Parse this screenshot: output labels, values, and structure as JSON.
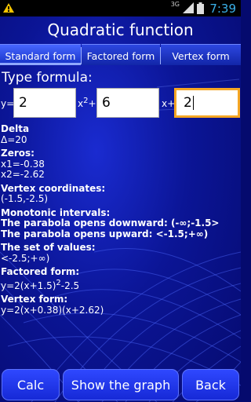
{
  "status": {
    "network": "3G",
    "time": "7:39"
  },
  "title": "Quadratic function",
  "tabs": [
    "Standard form",
    "Factored form",
    "Vertex form"
  ],
  "type_formula_label": "Type formula:",
  "inputs": {
    "y_label": "y=",
    "a": "2",
    "x2_label": "x",
    "x2_exp": "2",
    "x2_plus": "+",
    "b": "6",
    "x_label": "x+",
    "c": "2"
  },
  "results": {
    "delta_title": "Delta",
    "delta_value": "Δ=20",
    "zeros_title": "Zeros:",
    "x1": "x1=-0.38",
    "x2": "x2=-2.62",
    "vertex_title": "Vertex coordinates:",
    "vertex_value": "(-1.5,-2.5)",
    "monotonic_title": "Monotonic intervals:",
    "monotonic_down": "The parabola opens downward: (-∞;-1.5>",
    "monotonic_up": "The parabola opens upward: <-1.5;+∞)",
    "values_title": "The set of values:",
    "values_value": "<-2.5;+∞)",
    "factored_title": "Factored form:",
    "factored_pre": "y=2(x+1.5)",
    "factored_exp": "2",
    "factored_post": "-2.5",
    "vertex_form_title": "Vertex form:",
    "vertex_form_value": "y=2(x+0.38)(x+2.62)"
  },
  "buttons": {
    "calc": "Calc",
    "graph": "Show the graph",
    "back": "Back"
  },
  "colors": {
    "accent": "#f5a623",
    "button": "#1f35e8",
    "background": "#0b1596",
    "clock": "#3ab0e8"
  }
}
